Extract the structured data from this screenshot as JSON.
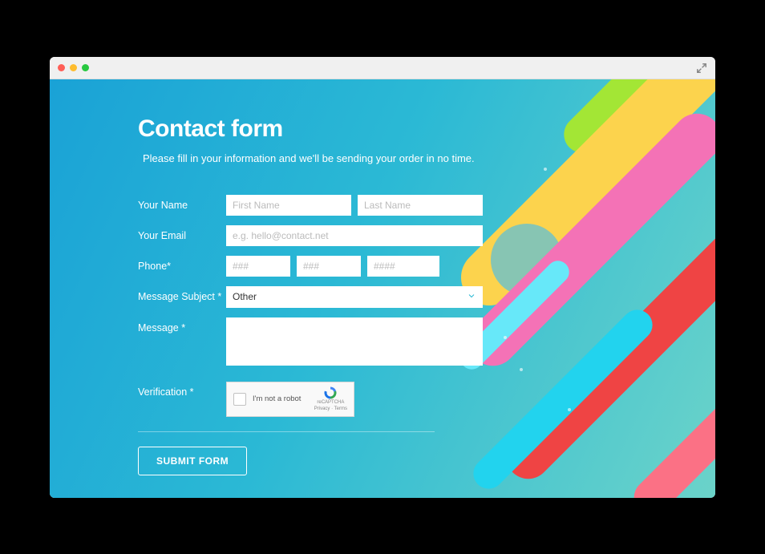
{
  "header": {
    "title": "Contact form",
    "subtitle": "Please fill in your information and we'll be sending your order in no time."
  },
  "form": {
    "name": {
      "label": "Your Name",
      "first_ph": "First Name",
      "last_ph": "Last Name"
    },
    "email": {
      "label": "Your Email",
      "ph": "e.g. hello@contact.net"
    },
    "phone": {
      "label": "Phone*",
      "ph1": "###",
      "ph2": "###",
      "ph3": "####"
    },
    "subject": {
      "label": "Message Subject *",
      "selected": "Other"
    },
    "message": {
      "label": "Message *"
    },
    "verification": {
      "label": "Verification *",
      "text": "I'm not a robot",
      "brand": "reCAPTCHA",
      "terms": "Privacy · Terms"
    },
    "submit": "SUBMIT FORM"
  }
}
